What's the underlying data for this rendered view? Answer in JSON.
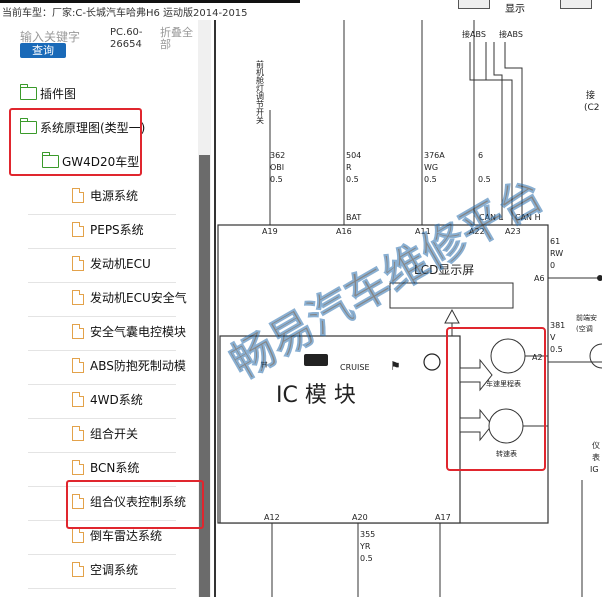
{
  "topbar": {
    "vehicle_label": "当前车型：厂家:C-长城汽车哈弗H6 运动版2014-2015",
    "toolbar_label": "显示"
  },
  "sidebar": {
    "search_placeholder": "输入关键字",
    "search_button": "查询",
    "pc_code": "PC.60-26654",
    "collapse_all": "折叠全部",
    "items": [
      {
        "label": "插件图",
        "icon": "folder-icon",
        "level": 0
      },
      {
        "label": "系统原理图(类型一)",
        "icon": "folder-open-icon",
        "level": 0
      },
      {
        "label": "GW4D20车型",
        "icon": "folder-open-icon",
        "level": 1
      },
      {
        "label": "电源系统",
        "icon": "document-icon",
        "level": 2
      },
      {
        "label": "PEPS系统",
        "icon": "document-icon",
        "level": 2
      },
      {
        "label": "发动机ECU",
        "icon": "document-icon",
        "level": 2
      },
      {
        "label": "发动机ECU安全气",
        "icon": "document-icon",
        "level": 2
      },
      {
        "label": "安全气囊电控模块",
        "icon": "document-icon",
        "level": 2
      },
      {
        "label": "ABS防抱死制动模",
        "icon": "document-icon",
        "level": 2
      },
      {
        "label": "4WD系统",
        "icon": "document-icon",
        "level": 2
      },
      {
        "label": "组合开关",
        "icon": "document-icon",
        "level": 2
      },
      {
        "label": "BCN系统",
        "icon": "document-icon",
        "level": 2
      },
      {
        "label": "组合仪表控制系统",
        "icon": "document-icon",
        "level": 2
      },
      {
        "label": "倒车雷达系统",
        "icon": "document-icon",
        "level": 2
      },
      {
        "label": "空调系统",
        "icon": "document-icon",
        "level": 2
      }
    ]
  },
  "diagram": {
    "top_labels": [
      "接ABS",
      "接ABS"
    ],
    "vertical_label": "前机舱灯调节开关",
    "right_edge_label": "接",
    "right_edge_sub": "(C2",
    "wires": [
      {
        "num": "362",
        "color": "OBI",
        "size": "0.5"
      },
      {
        "num": "504",
        "color": "R",
        "size": "0.5"
      },
      {
        "num": "376A",
        "color": "WG",
        "size": "0.5"
      },
      {
        "num": "6",
        "color": "",
        "size": "0.5"
      },
      {
        "num": "",
        "color": "",
        "size": ""
      },
      {
        "num": "61",
        "color": "RW",
        "size": "0"
      },
      {
        "num": "381",
        "color": "V",
        "size": "0.5"
      },
      {
        "num": "355",
        "color": "YR",
        "size": "0.5"
      }
    ],
    "pins_top": [
      "A19",
      "A16",
      "A11",
      "A22",
      "A23"
    ],
    "pins_right": [
      "A6",
      "A2"
    ],
    "pins_bottom": [
      "A12",
      "A20",
      "A17"
    ],
    "bus_labels": [
      "BAT",
      "CAN L",
      "CAN H"
    ],
    "lcd_label": "LCD显示屏",
    "cruise_label": "CRUISE",
    "module_label": "IC 模 块",
    "gauge1_label": "车速里程表",
    "gauge2_label": "转速表",
    "right_labels": [
      "前端安",
      "(空调"
    ],
    "right_bottom_labels": [
      "仪",
      "表",
      "IG"
    ],
    "watermark": "畅易汽车维修平台"
  },
  "colors": {
    "highlight": "#e0262e",
    "search_button": "#1a6ab8",
    "watermark": "#5aa0d8",
    "folder": "#3a9a2a",
    "document": "#e3a24a"
  }
}
